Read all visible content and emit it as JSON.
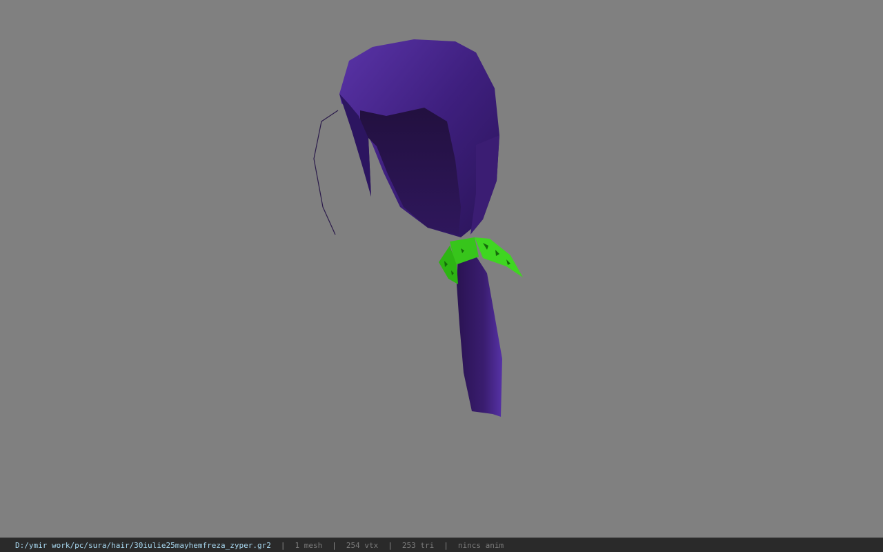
{
  "viewport": {
    "model_name": "hair mesh (purple ponytail with green ribbon)",
    "colors": {
      "background": "#808080",
      "hair_light": "#4a2a8a",
      "hair_dark": "#1e0e3e",
      "ribbon": "#3ad11c"
    }
  },
  "statusbar": {
    "file_path": "D:/ymir work/pc/sura/hair/30iulie25mayhemfreza_zyper.gr2",
    "separator": "|",
    "mesh_count": "1 mesh",
    "vertex_count": "254 vtx",
    "triangle_count": "253 tri",
    "animation": "nincs anim"
  }
}
